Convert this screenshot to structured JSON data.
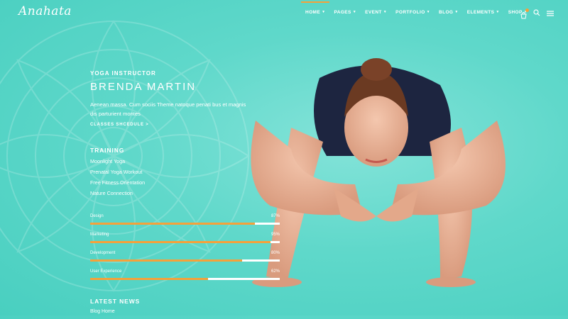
{
  "brand": {
    "logo": "Anahata",
    "accent": "#f5a13a",
    "background": "#5fd8ca"
  },
  "nav": {
    "items": [
      {
        "label": "HOME",
        "active": true
      },
      {
        "label": "PAGES"
      },
      {
        "label": "EVENT"
      },
      {
        "label": "PORTFOLIO"
      },
      {
        "label": "BLOG"
      },
      {
        "label": "ELEMENTS"
      },
      {
        "label": "SHOP"
      }
    ],
    "icons": [
      "cart-icon",
      "search-icon",
      "menu-icon"
    ]
  },
  "profile": {
    "role": "YOGA INSTRUCTOR",
    "name": "BRENDA MARTIN",
    "bio": "Aenean massa. Cum sociis Theme natoque penati bus et magnis dis parturient montes",
    "cta": "CLASSES SHCEDULE  >"
  },
  "training": {
    "title": "TRAINING",
    "items": [
      "Moonlight Yoga",
      "Prenatal Yoga Workout",
      "Free Fitness Orientation",
      "Nature Connection"
    ]
  },
  "skills": [
    {
      "label": "Design",
      "value": "87%",
      "fraction": 0.87
    },
    {
      "label": "Marketing",
      "value": "95%",
      "fraction": 0.95
    },
    {
      "label": "Development",
      "value": "80%",
      "fraction": 0.8
    },
    {
      "label": "User Experience",
      "value": "62%",
      "fraction": 0.62
    }
  ],
  "news": {
    "title": "LATEST NEWS",
    "first_item": "Blog Home"
  }
}
